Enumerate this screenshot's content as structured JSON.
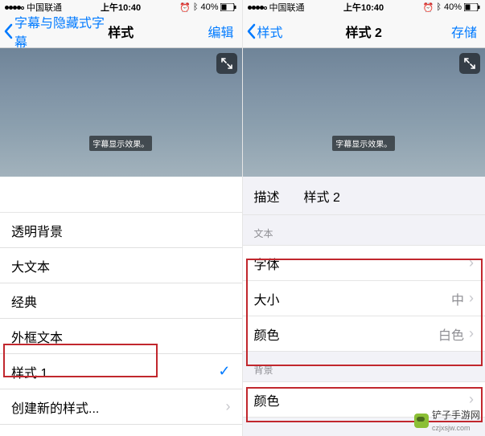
{
  "status": {
    "carrier": "中国联通",
    "time": "上午10:40",
    "battery": "40%"
  },
  "left": {
    "nav": {
      "back": "字幕与隐藏式字幕",
      "title": "样式",
      "action": "编辑"
    },
    "preview_caption": "字幕显示效果。",
    "styles": [
      {
        "label": "透明背景"
      },
      {
        "label": "大文本"
      },
      {
        "label": "经典"
      },
      {
        "label": "外框文本"
      },
      {
        "label": "样式 1",
        "selected": true
      },
      {
        "label": "创建新的样式...",
        "disclosure": true
      }
    ]
  },
  "right": {
    "nav": {
      "back": "样式",
      "title": "样式 2",
      "action": "存储"
    },
    "preview_caption": "字幕显示效果。",
    "desc_label": "描述",
    "desc_value": "样式 2",
    "sections": {
      "text_header": "文本",
      "text_rows": [
        {
          "label": "字体",
          "value": "",
          "disclosure": true
        },
        {
          "label": "大小",
          "value": "中",
          "disclosure": true
        },
        {
          "label": "颜色",
          "value": "白色",
          "disclosure": true
        }
      ],
      "bg_header": "背景",
      "bg_rows": [
        {
          "label": "颜色",
          "value": "",
          "disclosure": true
        }
      ]
    }
  },
  "watermark": {
    "name": "铲子手游网",
    "url": "czjxsjw.com"
  },
  "icons": {
    "expand": "expand-icon"
  }
}
